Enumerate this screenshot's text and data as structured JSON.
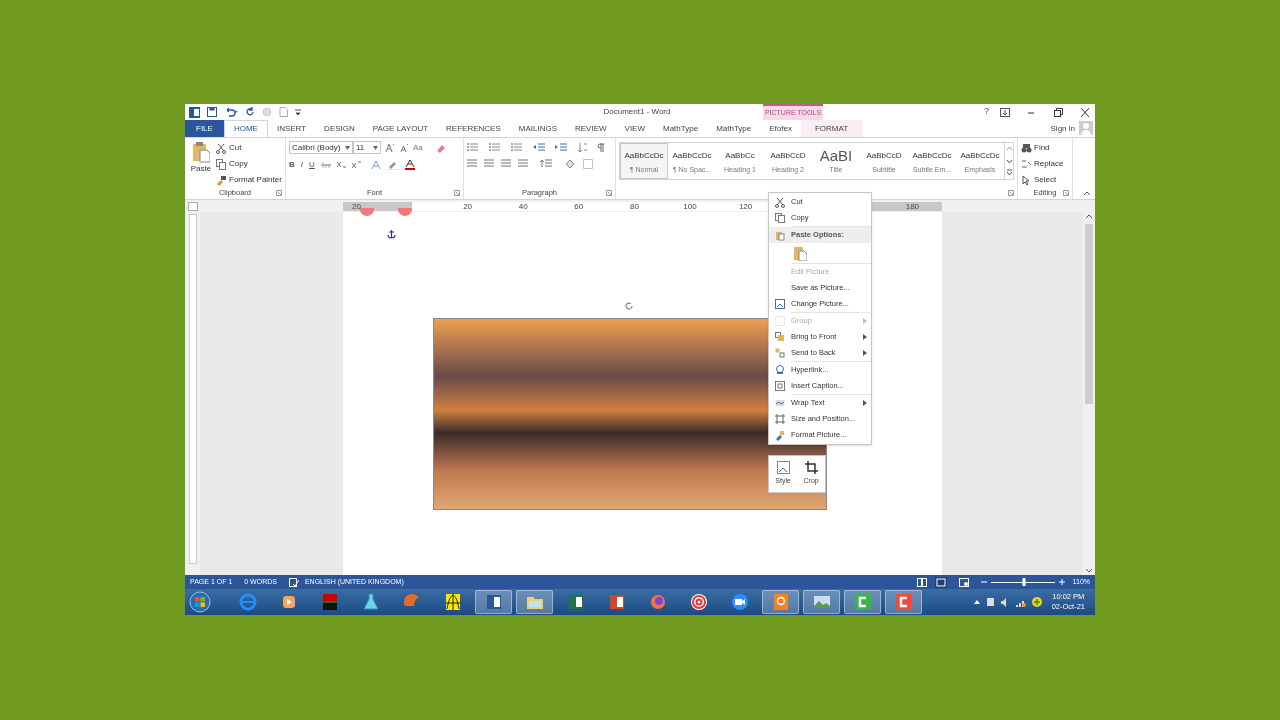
{
  "window": {
    "title": "Document1 - Word",
    "contextual_group": "PICTURE TOOLS",
    "help": "?",
    "sign_in": "Sign in"
  },
  "tabs": [
    {
      "label": "FILE",
      "kind": "file",
      "selected": false
    },
    {
      "label": "HOME",
      "kind": "tab",
      "selected": true
    },
    {
      "label": "INSERT",
      "kind": "tab",
      "selected": false
    },
    {
      "label": "DESIGN",
      "kind": "tab",
      "selected": false
    },
    {
      "label": "PAGE LAYOUT",
      "kind": "tab",
      "selected": false
    },
    {
      "label": "REFERENCES",
      "kind": "tab",
      "selected": false
    },
    {
      "label": "MAILINGS",
      "kind": "tab",
      "selected": false
    },
    {
      "label": "REVIEW",
      "kind": "tab",
      "selected": false
    },
    {
      "label": "VIEW",
      "kind": "tab",
      "selected": false
    },
    {
      "label": "MathType",
      "kind": "tab",
      "selected": false
    },
    {
      "label": "MathType",
      "kind": "tab",
      "selected": false
    },
    {
      "label": "Efofex",
      "kind": "tab",
      "selected": false
    },
    {
      "label": "FORMAT",
      "kind": "contextual",
      "selected": false
    }
  ],
  "clipboard": {
    "paste": "Paste",
    "cut": "Cut",
    "copy": "Copy",
    "format_painter": "Format Painter",
    "label": "Clipboard"
  },
  "font": {
    "family": "Calibri (Body)",
    "size": "11",
    "change_case": "Aa",
    "bold": "B",
    "italic": "I",
    "underline": "U",
    "label": "Font"
  },
  "paragraph": {
    "label": "Paragraph"
  },
  "styles": [
    {
      "sample": "AaBbCcDc",
      "name": "¶ Normal",
      "selected": true
    },
    {
      "sample": "AaBbCcDc",
      "name": "¶ No Spac...",
      "selected": false
    },
    {
      "sample": "AaBbCc",
      "name": "Heading 1",
      "selected": false
    },
    {
      "sample": "AaBbCcD",
      "name": "Heading 2",
      "selected": false
    },
    {
      "sample": "AaBI",
      "name": "Title",
      "selected": false
    },
    {
      "sample": "AaBbCcD",
      "name": "Subtitle",
      "selected": false
    },
    {
      "sample": "AaBbCcDc",
      "name": "Subtle Em...",
      "selected": false
    },
    {
      "sample": "AaBbCcDc",
      "name": "Emphasis",
      "selected": false
    }
  ],
  "editing": {
    "find": "Find",
    "replace": "Replace",
    "select": "Select",
    "label": "Editing"
  },
  "ruler": [
    {
      "label": "20",
      "kind": "margin"
    },
    {
      "label": "20",
      "kind": "body"
    },
    {
      "label": "40",
      "kind": "body"
    },
    {
      "label": "60",
      "kind": "body"
    },
    {
      "label": "80",
      "kind": "body"
    },
    {
      "label": "100",
      "kind": "body"
    },
    {
      "label": "120",
      "kind": "body"
    },
    {
      "label": "180",
      "kind": "body"
    }
  ],
  "context_menu": [
    {
      "label": "Cut",
      "kind": "item",
      "disabled": false,
      "submenu": false
    },
    {
      "label": "Copy",
      "kind": "item",
      "disabled": false,
      "submenu": false
    },
    {
      "label": "Paste Options:",
      "kind": "header",
      "disabled": false,
      "submenu": false
    },
    {
      "kind": "paste_row"
    },
    {
      "label": "Edit Picture",
      "kind": "item",
      "disabled": true,
      "submenu": false
    },
    {
      "label": "Save as Picture...",
      "kind": "item",
      "disabled": false,
      "submenu": false
    },
    {
      "label": "Change Picture...",
      "kind": "item",
      "disabled": false,
      "submenu": false
    },
    {
      "label": "Group",
      "kind": "item",
      "disabled": true,
      "submenu": true
    },
    {
      "label": "Bring to Front",
      "kind": "item",
      "disabled": false,
      "submenu": true
    },
    {
      "label": "Send to Back",
      "kind": "item",
      "disabled": false,
      "submenu": true
    },
    {
      "label": "Hyperlink...",
      "kind": "item",
      "disabled": false,
      "submenu": false
    },
    {
      "label": "Insert Caption...",
      "kind": "item",
      "disabled": false,
      "submenu": false
    },
    {
      "label": "Wrap Text",
      "kind": "item",
      "disabled": false,
      "submenu": true
    },
    {
      "label": "Size and Position...",
      "kind": "item",
      "disabled": false,
      "submenu": false
    },
    {
      "label": "Format Picture...",
      "kind": "item",
      "disabled": false,
      "submenu": false
    }
  ],
  "mini_toolbar": [
    {
      "label": "Style",
      "kind": "style"
    },
    {
      "label": "Crop",
      "kind": "crop"
    }
  ],
  "status_bar": {
    "page": "PAGE 1 OF 1",
    "words": "0 WORDS",
    "language": "ENGLISH (UNITED KINGDOM)",
    "zoom": "110%",
    "zoom_slider": {
      "level": 0.52
    }
  },
  "taskbar": {
    "apps": [
      {
        "kind": "ie",
        "running": false
      },
      {
        "kind": "media",
        "running": false
      },
      {
        "kind": "cod",
        "running": false
      },
      {
        "kind": "flask",
        "running": false
      },
      {
        "kind": "shell",
        "running": false
      },
      {
        "kind": "graph",
        "running": false
      },
      {
        "kind": "word",
        "running": true
      },
      {
        "kind": "explorer",
        "running": true
      },
      {
        "kind": "excel",
        "running": false
      },
      {
        "kind": "powerpoint",
        "running": false
      },
      {
        "kind": "firefox",
        "running": false
      },
      {
        "kind": "spiral",
        "running": false
      },
      {
        "kind": "zoom",
        "running": false
      },
      {
        "kind": "pdf",
        "running": true
      },
      {
        "kind": "photos",
        "running": true
      },
      {
        "kind": "green_c",
        "running": true
      },
      {
        "kind": "red_c",
        "running": true
      }
    ],
    "time": "10:02 PM",
    "date": "02-Oct-21"
  }
}
